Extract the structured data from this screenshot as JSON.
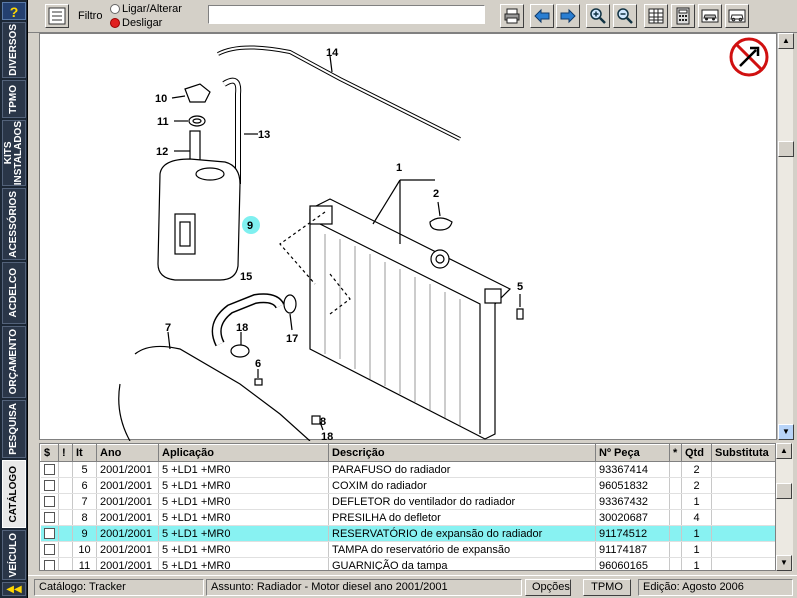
{
  "sidebar": {
    "help_label": "?",
    "collapse_label": "◀◀",
    "tabs": [
      {
        "label": "DIVERSOS",
        "active": false
      },
      {
        "label": "TPMO",
        "active": false
      },
      {
        "label": "KITS\nINSTALADOS",
        "active": false
      },
      {
        "label": "ACESSÓRIOS",
        "active": false
      },
      {
        "label": "ACDELCO",
        "active": false
      },
      {
        "label": "ORÇAMENTO",
        "active": false
      },
      {
        "label": "PESQUISA",
        "active": false
      },
      {
        "label": "CATÁLOGO",
        "active": true
      },
      {
        "label": "VEÍCULO",
        "active": false
      }
    ]
  },
  "toolbar": {
    "filter_label": "Filtro",
    "radio_on_label": "Ligar/Alterar",
    "radio_off_label": "Desligar",
    "search_value": ""
  },
  "drawing": {
    "callouts": [
      "1",
      "2",
      "5",
      "6",
      "7",
      "8",
      "9",
      "10",
      "11",
      "12",
      "13",
      "14",
      "15",
      "17",
      "18",
      "18"
    ],
    "highlight_callout": "9"
  },
  "table": {
    "headers": [
      "$",
      "!",
      "It",
      "Ano",
      "Aplicação",
      "Descrição",
      "Nº Peça",
      "*",
      "Qtd",
      "Substituta"
    ],
    "rows": [
      {
        "it": "5",
        "ano": "2001/2001",
        "aplicacao": "5 +LD1 +MR0",
        "descricao": "PARAFUSO do radiador",
        "peca": "93367414",
        "star": "",
        "qtd": "2",
        "substituta": "",
        "selected": false
      },
      {
        "it": "6",
        "ano": "2001/2001",
        "aplicacao": "5 +LD1 +MR0",
        "descricao": "COXIM do radiador",
        "peca": "96051832",
        "star": "",
        "qtd": "2",
        "substituta": "",
        "selected": false
      },
      {
        "it": "7",
        "ano": "2001/2001",
        "aplicacao": "5 +LD1 +MR0",
        "descricao": "DEFLETOR do ventilador do radiador",
        "peca": "93367432",
        "star": "",
        "qtd": "1",
        "substituta": "",
        "selected": false
      },
      {
        "it": "8",
        "ano": "2001/2001",
        "aplicacao": "5 +LD1 +MR0",
        "descricao": "PRESILHA do defletor",
        "peca": "30020687",
        "star": "",
        "qtd": "4",
        "substituta": "",
        "selected": false
      },
      {
        "it": "9",
        "ano": "2001/2001",
        "aplicacao": "5 +LD1 +MR0",
        "descricao": "RESERVATÓRIO de expansão do radiador",
        "peca": "91174512",
        "star": "",
        "qtd": "1",
        "substituta": "",
        "selected": true
      },
      {
        "it": "10",
        "ano": "2001/2001",
        "aplicacao": "5 +LD1 +MR0",
        "descricao": "TAMPA do reservatório de expansão",
        "peca": "91174187",
        "star": "",
        "qtd": "1",
        "substituta": "",
        "selected": false
      },
      {
        "it": "11",
        "ano": "2001/2001",
        "aplicacao": "5 +LD1 +MR0",
        "descricao": "GUARNIÇÃO da tampa",
        "peca": "96060165",
        "star": "",
        "qtd": "1",
        "substituta": "",
        "selected": false
      }
    ]
  },
  "statusbar": {
    "catalogo": "Catálogo: Tracker",
    "assunto": "Assunto: Radiador - Motor diesel ano 2001/2001",
    "opcoes": "Opções",
    "tpmo": "TPMO",
    "edicao": "Edição: Agosto 2006"
  },
  "colors": {
    "selected_row": "#88f2f2",
    "sidebar_bg": "#1c2735",
    "highlight_circle": "#7ff0f0"
  }
}
